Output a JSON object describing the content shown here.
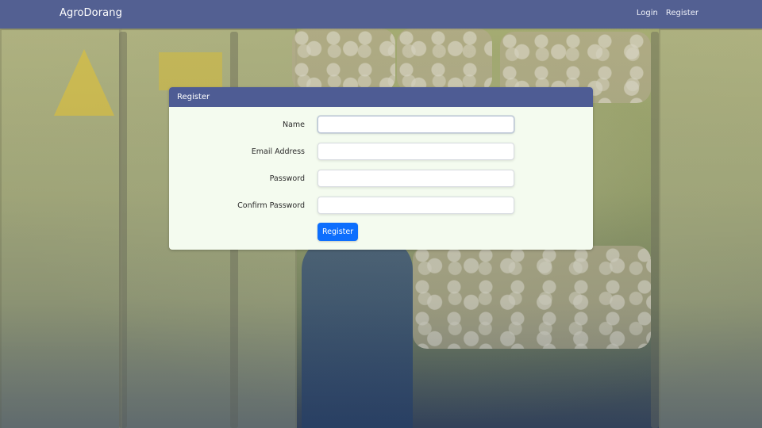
{
  "navbar": {
    "brand": "AgroDorang",
    "links": [
      {
        "label": "Login"
      },
      {
        "label": "Register"
      }
    ]
  },
  "card": {
    "title": "Register",
    "fields": [
      {
        "label": "Name",
        "value": "",
        "type": "text"
      },
      {
        "label": "Email Address",
        "value": "",
        "type": "email"
      },
      {
        "label": "Password",
        "value": "",
        "type": "password"
      },
      {
        "label": "Confirm Password",
        "value": "",
        "type": "password"
      }
    ],
    "submit_label": "Register"
  },
  "colors": {
    "navbar": "#4e5c94",
    "card_header": "#4e5c94",
    "card_body": "#f4fbef",
    "primary_button": "#0d6efd"
  }
}
